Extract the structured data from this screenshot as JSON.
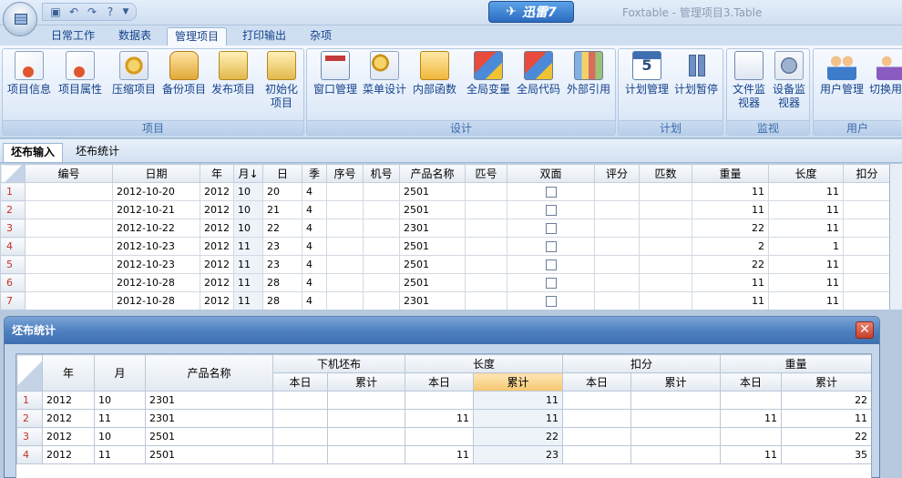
{
  "titlebar": {
    "xunlei_label": "迅雷7",
    "window_title": "Foxtable - 管理项目3.Table",
    "qat": {
      "save_icon": "save-icon",
      "undo_icon": "undo-icon",
      "redo_icon": "redo-icon",
      "help_icon": "help-icon",
      "dropdown_icon": "dropdown-icon"
    }
  },
  "tabs": [
    "日常工作",
    "数据表",
    "管理项目",
    "打印输出",
    "杂项"
  ],
  "ribbon": {
    "groups": [
      {
        "label": "项目",
        "buttons": [
          "项目信息",
          "项目属性",
          "压缩项目",
          "备份项目",
          "发布项目",
          "初始化项目"
        ]
      },
      {
        "label": "设计",
        "buttons": [
          "窗口管理",
          "菜单设计",
          "内部函数",
          "全局变量",
          "全局代码",
          "外部引用"
        ]
      },
      {
        "label": "计划",
        "buttons": [
          "计划管理",
          "计划暂停"
        ]
      },
      {
        "label": "监视",
        "buttons": [
          "文件监视器",
          "设备监视器"
        ]
      },
      {
        "label": "用户",
        "buttons": [
          "用户管理",
          "切换用户"
        ]
      }
    ]
  },
  "sheet_tabs": [
    "坯布输入",
    "坯布统计"
  ],
  "main_table": {
    "columns": [
      "编号",
      "日期",
      "年",
      "月",
      "日",
      "季",
      "序号",
      "机号",
      "产品名称",
      "匹号",
      "双面",
      "评分",
      "匹数",
      "重量",
      "长度",
      "扣分"
    ],
    "sort_indicator": "↓",
    "rows": [
      {
        "n": "1",
        "date": "2012-10-20",
        "year": "2012",
        "month": "10",
        "day": "20",
        "season": "4",
        "product": "2501",
        "weight": "11",
        "length": "11"
      },
      {
        "n": "2",
        "date": "2012-10-21",
        "year": "2012",
        "month": "10",
        "day": "21",
        "season": "4",
        "product": "2501",
        "weight": "11",
        "length": "11"
      },
      {
        "n": "3",
        "date": "2012-10-22",
        "year": "2012",
        "month": "10",
        "day": "22",
        "season": "4",
        "product": "2301",
        "weight": "22",
        "length": "11"
      },
      {
        "n": "4",
        "date": "2012-10-23",
        "year": "2012",
        "month": "11",
        "day": "23",
        "season": "4",
        "product": "2501",
        "weight": "2",
        "length": "1"
      },
      {
        "n": "5",
        "date": "2012-10-23",
        "year": "2012",
        "month": "11",
        "day": "23",
        "season": "4",
        "product": "2501",
        "weight": "22",
        "length": "11"
      },
      {
        "n": "6",
        "date": "2012-10-28",
        "year": "2012",
        "month": "11",
        "day": "28",
        "season": "4",
        "product": "2501",
        "weight": "11",
        "length": "11"
      },
      {
        "n": "7",
        "date": "2012-10-28",
        "year": "2012",
        "month": "11",
        "day": "28",
        "season": "4",
        "product": "2301",
        "weight": "11",
        "length": "11"
      }
    ]
  },
  "dialog": {
    "title": "坯布统计",
    "headers": {
      "year": "年",
      "month": "月",
      "product": "产品名称",
      "groups": [
        "下机坯布",
        "长度",
        "扣分",
        "重量"
      ],
      "sub": [
        "本日",
        "累计"
      ]
    },
    "rows": [
      {
        "n": "1",
        "year": "2012",
        "month": "10",
        "product": "2301",
        "xj_day": "",
        "xj_total": "",
        "len_day": "",
        "len_total": "11",
        "kf_day": "",
        "kf_total": "",
        "wt_day": "",
        "wt_total": "22"
      },
      {
        "n": "2",
        "year": "2012",
        "month": "11",
        "product": "2301",
        "xj_day": "",
        "xj_total": "",
        "len_day": "11",
        "len_total": "11",
        "kf_day": "",
        "kf_total": "",
        "wt_day": "11",
        "wt_total": "11"
      },
      {
        "n": "3",
        "year": "2012",
        "month": "10",
        "product": "2501",
        "xj_day": "",
        "xj_total": "",
        "len_day": "",
        "len_total": "22",
        "kf_day": "",
        "kf_total": "",
        "wt_day": "",
        "wt_total": "22"
      },
      {
        "n": "4",
        "year": "2012",
        "month": "11",
        "product": "2501",
        "xj_day": "",
        "xj_total": "",
        "len_day": "11",
        "len_total": "23",
        "kf_day": "",
        "kf_total": "",
        "wt_day": "11",
        "wt_total": "35"
      }
    ]
  },
  "colors": {
    "accent": "#15428b",
    "row_header_text": "#c4322a",
    "highlight_header": "#f7c76e"
  }
}
